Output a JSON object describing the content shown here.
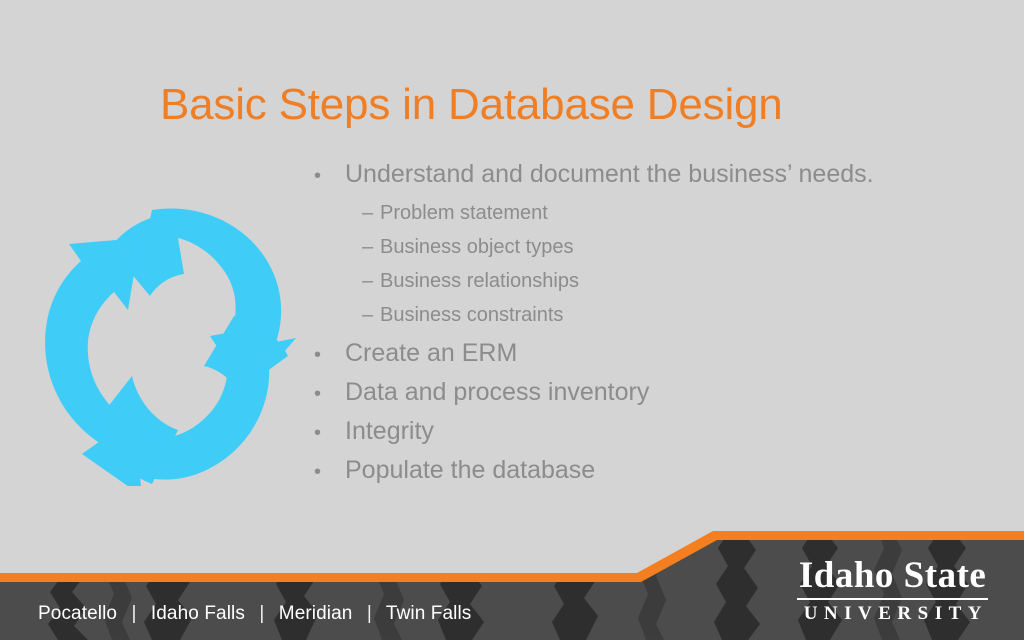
{
  "slide": {
    "title": "Basic Steps in Database Design",
    "background_color": "#d4d4d4",
    "title_color": "#ef7e24",
    "body_text_color": "#8c8c8c"
  },
  "graphic": {
    "name": "recycling-cycle-arrows",
    "color": "#3fcdf8",
    "arrow_count": 3
  },
  "content": {
    "bullets": [
      {
        "marker": "•",
        "text": "Understand and document the business’ needs.",
        "sub_bullets": [
          {
            "marker": "–",
            "text": "Problem statement"
          },
          {
            "marker": "–",
            "text": "Business object types"
          },
          {
            "marker": "–",
            "text": "Business relationships"
          },
          {
            "marker": "–",
            "text": "Business constraints"
          }
        ]
      },
      {
        "marker": "•",
        "text": "Create an ERM",
        "sub_bullets": []
      },
      {
        "marker": "•",
        "text": "Data and process inventory",
        "sub_bullets": []
      },
      {
        "marker": "•",
        "text": "Integrity",
        "sub_bullets": []
      },
      {
        "marker": "•",
        "text": "Populate the database",
        "sub_bullets": []
      }
    ]
  },
  "footer": {
    "accent_color": "#f47f20",
    "background_color": "#4c4c4c",
    "campuses": [
      "Pocatello",
      "Idaho Falls",
      "Meridian",
      "Twin Falls"
    ],
    "separator": "|",
    "logo": {
      "wordmark": "Idaho State",
      "subtitle": "UNIVERSITY"
    }
  }
}
